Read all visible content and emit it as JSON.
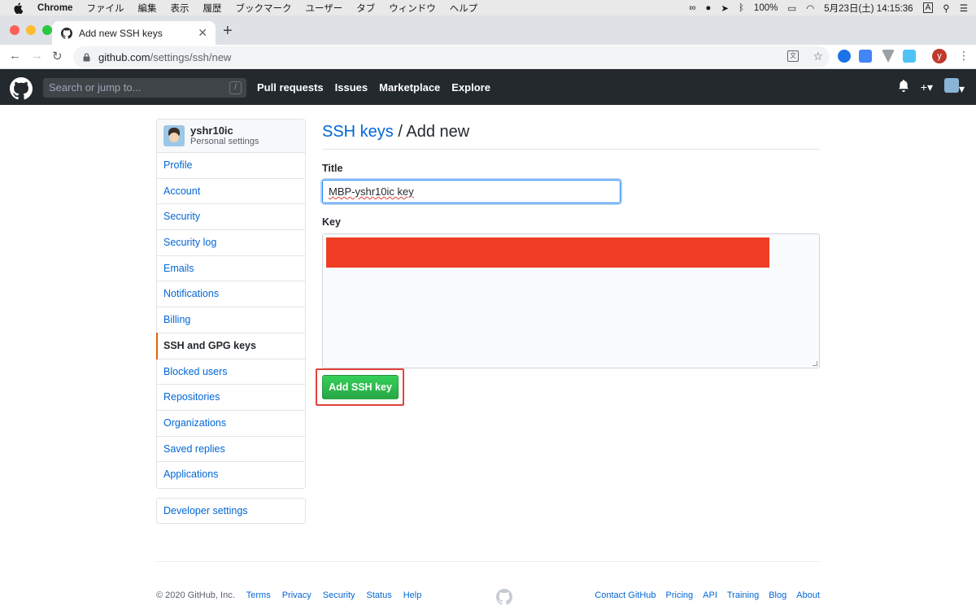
{
  "macos_menubar": {
    "app": "Chrome",
    "menus": [
      "ファイル",
      "編集",
      "表示",
      "履歴",
      "ブックマーク",
      "ユーザー",
      "タブ",
      "ウィンドウ",
      "ヘルプ"
    ],
    "battery": "100%",
    "datetime": "5月23日(土)  14:15:36",
    "input_method": "A"
  },
  "browser": {
    "tab_title": "Add new SSH keys",
    "url_host": "github.com",
    "url_path": "/settings/ssh/new",
    "profile_initial": "y"
  },
  "github_header": {
    "search_placeholder": "Search or jump to...",
    "search_shortcut": "/",
    "nav": [
      "Pull requests",
      "Issues",
      "Marketplace",
      "Explore"
    ]
  },
  "sidebar": {
    "username": "yshr10ic",
    "subtitle": "Personal settings",
    "items": [
      {
        "label": "Profile"
      },
      {
        "label": "Account"
      },
      {
        "label": "Security"
      },
      {
        "label": "Security log"
      },
      {
        "label": "Emails"
      },
      {
        "label": "Notifications"
      },
      {
        "label": "Billing"
      },
      {
        "label": "SSH and GPG keys",
        "active": true
      },
      {
        "label": "Blocked users"
      },
      {
        "label": "Repositories"
      },
      {
        "label": "Organizations"
      },
      {
        "label": "Saved replies"
      },
      {
        "label": "Applications"
      }
    ],
    "developer_settings": "Developer settings"
  },
  "form": {
    "heading_link": "SSH keys",
    "heading_rest": " / Add new",
    "title_label": "Title",
    "title_value": "MBP-yshr10ic key",
    "key_label": "Key",
    "submit_label": "Add SSH key"
  },
  "footer": {
    "copyright": "© 2020 GitHub, Inc.",
    "left_links": [
      "Terms",
      "Privacy",
      "Security",
      "Status",
      "Help"
    ],
    "right_links": [
      "Contact GitHub",
      "Pricing",
      "API",
      "Training",
      "Blog",
      "About"
    ]
  },
  "colors": {
    "link": "#0366d6",
    "header_bg": "#24292e",
    "button_green": "#28a745",
    "highlight_red": "#e0443d",
    "active_accent": "#e36209"
  }
}
